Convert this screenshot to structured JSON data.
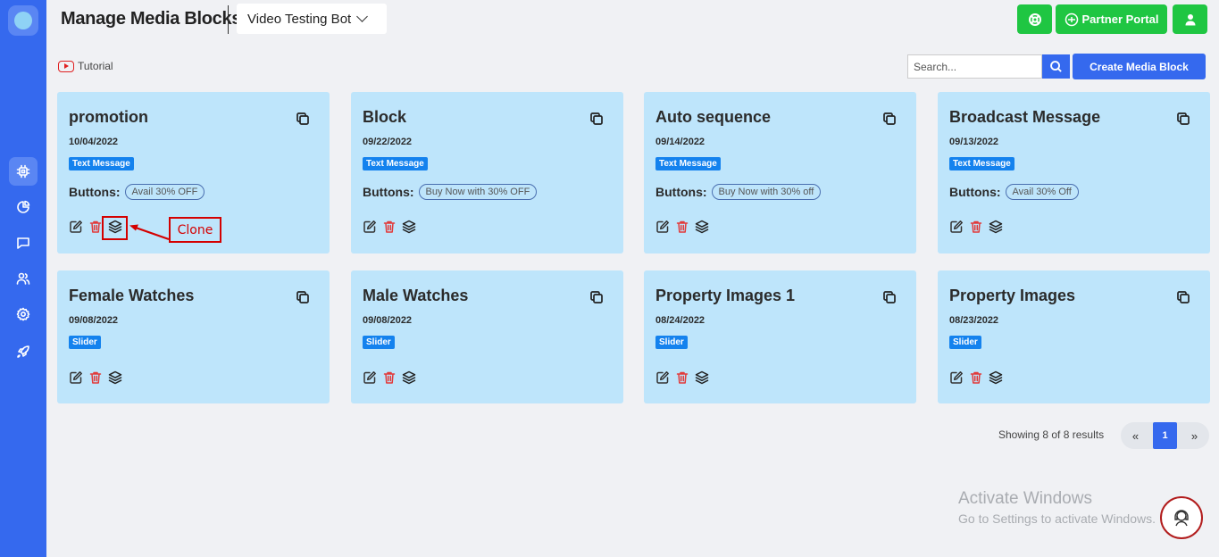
{
  "header": {
    "title": "Manage Media Blocks",
    "bot_name": "Video Testing Bot",
    "partner_portal": "Partner Portal"
  },
  "toolbar": {
    "tutorial": "Tutorial",
    "search_placeholder": "Search...",
    "create_label": "Create Media Block"
  },
  "sidebar": {
    "items": [
      {
        "icon": "chip-icon",
        "active": true
      },
      {
        "icon": "pie-chart-icon",
        "active": false
      },
      {
        "icon": "chat-icon",
        "active": false
      },
      {
        "icon": "users-icon",
        "active": false
      },
      {
        "icon": "gear-icon",
        "active": false
      },
      {
        "icon": "rocket-icon",
        "active": false
      }
    ]
  },
  "cards": [
    {
      "title": "promotion",
      "date": "10/04/2022",
      "type": "Text Message",
      "buttons_label": "Buttons:",
      "button": "Avail 30% OFF"
    },
    {
      "title": "Block",
      "date": "09/22/2022",
      "type": "Text Message",
      "buttons_label": "Buttons:",
      "button": "Buy Now with 30% OFF"
    },
    {
      "title": "Auto sequence",
      "date": "09/14/2022",
      "type": "Text Message",
      "buttons_label": "Buttons:",
      "button": "Buy Now with 30% off"
    },
    {
      "title": "Broadcast Message",
      "date": "09/13/2022",
      "type": "Text Message",
      "buttons_label": "Buttons:",
      "button": "Avail 30% Off"
    },
    {
      "title": "Female Watches",
      "date": "09/08/2022",
      "type": "Slider"
    },
    {
      "title": "Male Watches",
      "date": "09/08/2022",
      "type": "Slider"
    },
    {
      "title": "Property Images 1",
      "date": "08/24/2022",
      "type": "Slider"
    },
    {
      "title": "Property Images",
      "date": "08/23/2022",
      "type": "Slider"
    }
  ],
  "annotation": {
    "label": "Clone"
  },
  "pagination": {
    "results": "Showing 8 of 8 results",
    "prev": "«",
    "current": "1",
    "next": "»"
  },
  "watermark": {
    "line1": "Activate Windows",
    "line2": "Go to Settings to activate Windows."
  },
  "colors": {
    "primary": "#3569ee",
    "green": "#1fc642",
    "card": "#bee5fb",
    "badge": "#1482ee",
    "annotation": "#d40000"
  }
}
